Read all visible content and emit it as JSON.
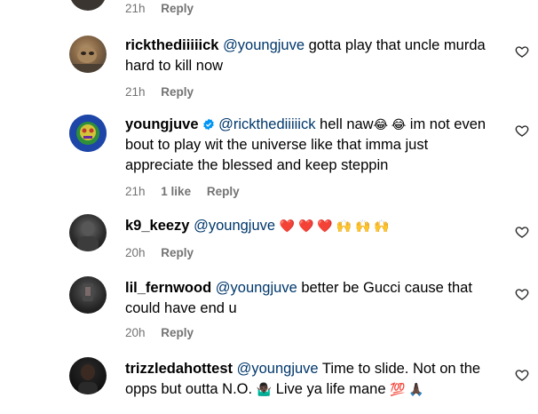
{
  "colors": {
    "text": "#000000",
    "mention": "#00376b",
    "meta": "#737373",
    "verified": "#0095f6"
  },
  "top_meta": {
    "time": "21h",
    "reply": "Reply"
  },
  "comments": [
    {
      "username": "rickthediiiiick",
      "mention": "@youngjuve",
      "text": " gotta play that uncle murda hard to kill now",
      "time": "21h",
      "reply": "Reply",
      "icon": "heart-outline-icon"
    },
    {
      "username": "youngjuve",
      "verified": true,
      "mention": "@rickthediiiiick",
      "text_a": " hell naw",
      "emoji_a": "😂 😂",
      "text_b": "  im not even bout to play wit the universe like that imma just appreciate the blessed and keep steppin",
      "time": "21h",
      "likes": "1 like",
      "reply": "Reply",
      "icon": "heart-outline-icon"
    },
    {
      "username": "k9_keezy",
      "mention": "@youngjuve",
      "emoji": "❤️ ❤️ ❤️ 🙌 🙌 🙌",
      "time": "20h",
      "reply": "Reply",
      "icon": "heart-outline-icon"
    },
    {
      "username": "lil_fernwood",
      "mention": "@youngjuve",
      "text": " better be Gucci cause that could have end u",
      "time": "20h",
      "reply": "Reply",
      "icon": "heart-outline-icon"
    },
    {
      "username": "trizzledahottest",
      "mention": "@youngjuve",
      "text_a": " Time to slide. Not on the opps but outta N.O. ",
      "emoji_a": "🤷🏿‍♂️",
      "text_b": " Live ya life mane ",
      "emoji_b": "💯 🙏🏿",
      "icon": "heart-outline-icon"
    }
  ]
}
